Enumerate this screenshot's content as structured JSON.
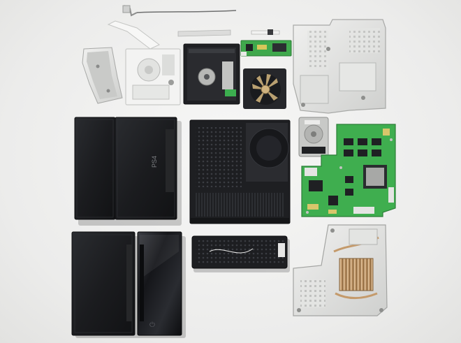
{
  "photo": {
    "components": [
      {
        "name": "ribbon-cables"
      },
      {
        "name": "metal-bracket"
      },
      {
        "name": "blu-ray-drive-frame"
      },
      {
        "name": "blu-ray-drive"
      },
      {
        "name": "small-circuit-board"
      },
      {
        "name": "cooling-fan"
      },
      {
        "name": "metal-shield-top-right"
      },
      {
        "name": "console-top-cover-left"
      },
      {
        "name": "console-top-cover-right"
      },
      {
        "name": "internal-chassis-frame"
      },
      {
        "name": "hard-drive"
      },
      {
        "name": "motherboard"
      },
      {
        "name": "console-bottom-cover"
      },
      {
        "name": "console-glossy-cover"
      },
      {
        "name": "power-supply-unit"
      },
      {
        "name": "heatsink-frame-bottom-right"
      }
    ],
    "colors": {
      "background": "#efefee",
      "black_plastic": "#1c1d20",
      "pcb_green": "#3fae4f",
      "metal": "#d9dad8",
      "copper": "#c9a67a"
    }
  }
}
